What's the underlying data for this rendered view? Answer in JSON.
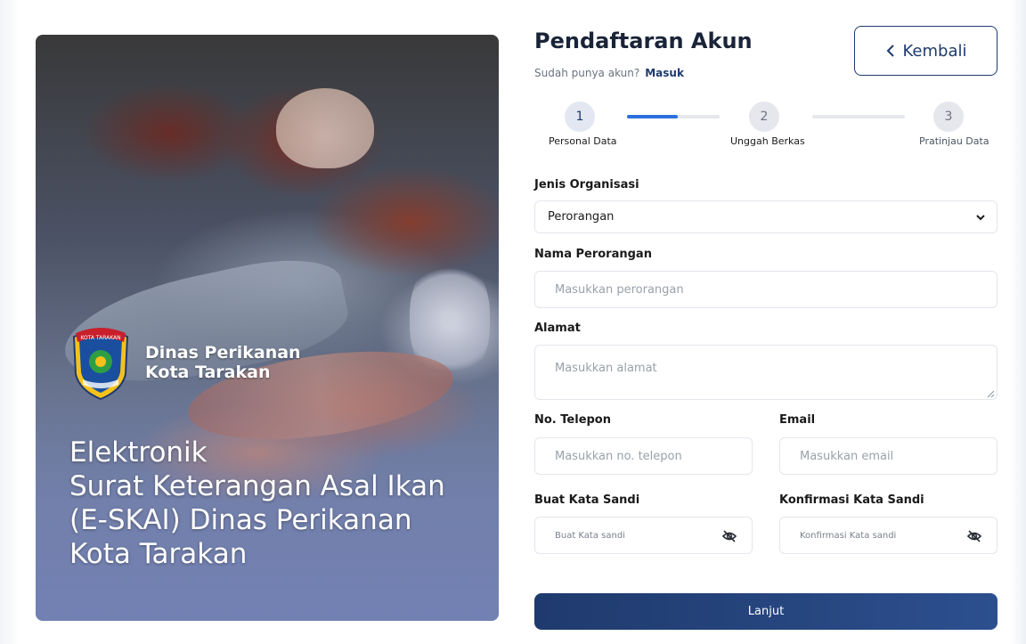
{
  "hero": {
    "org_name_line1": "Dinas Perikanan",
    "org_name_line2": "Kota Tarakan",
    "emblem_text": "KOTA TARAKAN",
    "title_line1": "Elektronik",
    "title_line2": "Surat Keterangan Asal Ikan",
    "title_line3": "(E-SKAI) Dinas Perikanan",
    "title_line4": "Kota Tarakan"
  },
  "header": {
    "title": "Pendaftaran Akun",
    "subtitle": "Sudah punya akun?",
    "login_link": "Masuk",
    "back_label": "Kembali"
  },
  "stepper": {
    "steps": [
      {
        "number": "1",
        "label": "Personal Data"
      },
      {
        "number": "2",
        "label": "Unggah Berkas"
      },
      {
        "number": "3",
        "label": "Pratinjau Data"
      }
    ],
    "current_step_progress": 0.55
  },
  "form": {
    "org_type": {
      "label": "Jenis Organisasi",
      "value": "Perorangan"
    },
    "name": {
      "label": "Nama Perorangan",
      "placeholder": "Masukkan perorangan"
    },
    "address": {
      "label": "Alamat",
      "placeholder": "Masukkan alamat"
    },
    "phone": {
      "label": "No. Telepon",
      "placeholder": "Masukkan no. telepon"
    },
    "email": {
      "label": "Email",
      "placeholder": "Masukkan email"
    },
    "password": {
      "label": "Buat Kata Sandi",
      "placeholder": "Buat Kata sandi"
    },
    "confirm_password": {
      "label": "Konfirmasi Kata Sandi",
      "placeholder": "Konfirmasi Kata sandi"
    },
    "submit_label": "Lanjut"
  },
  "colors": {
    "primary": "#1f3a6d",
    "progress": "#2a6fe0"
  }
}
